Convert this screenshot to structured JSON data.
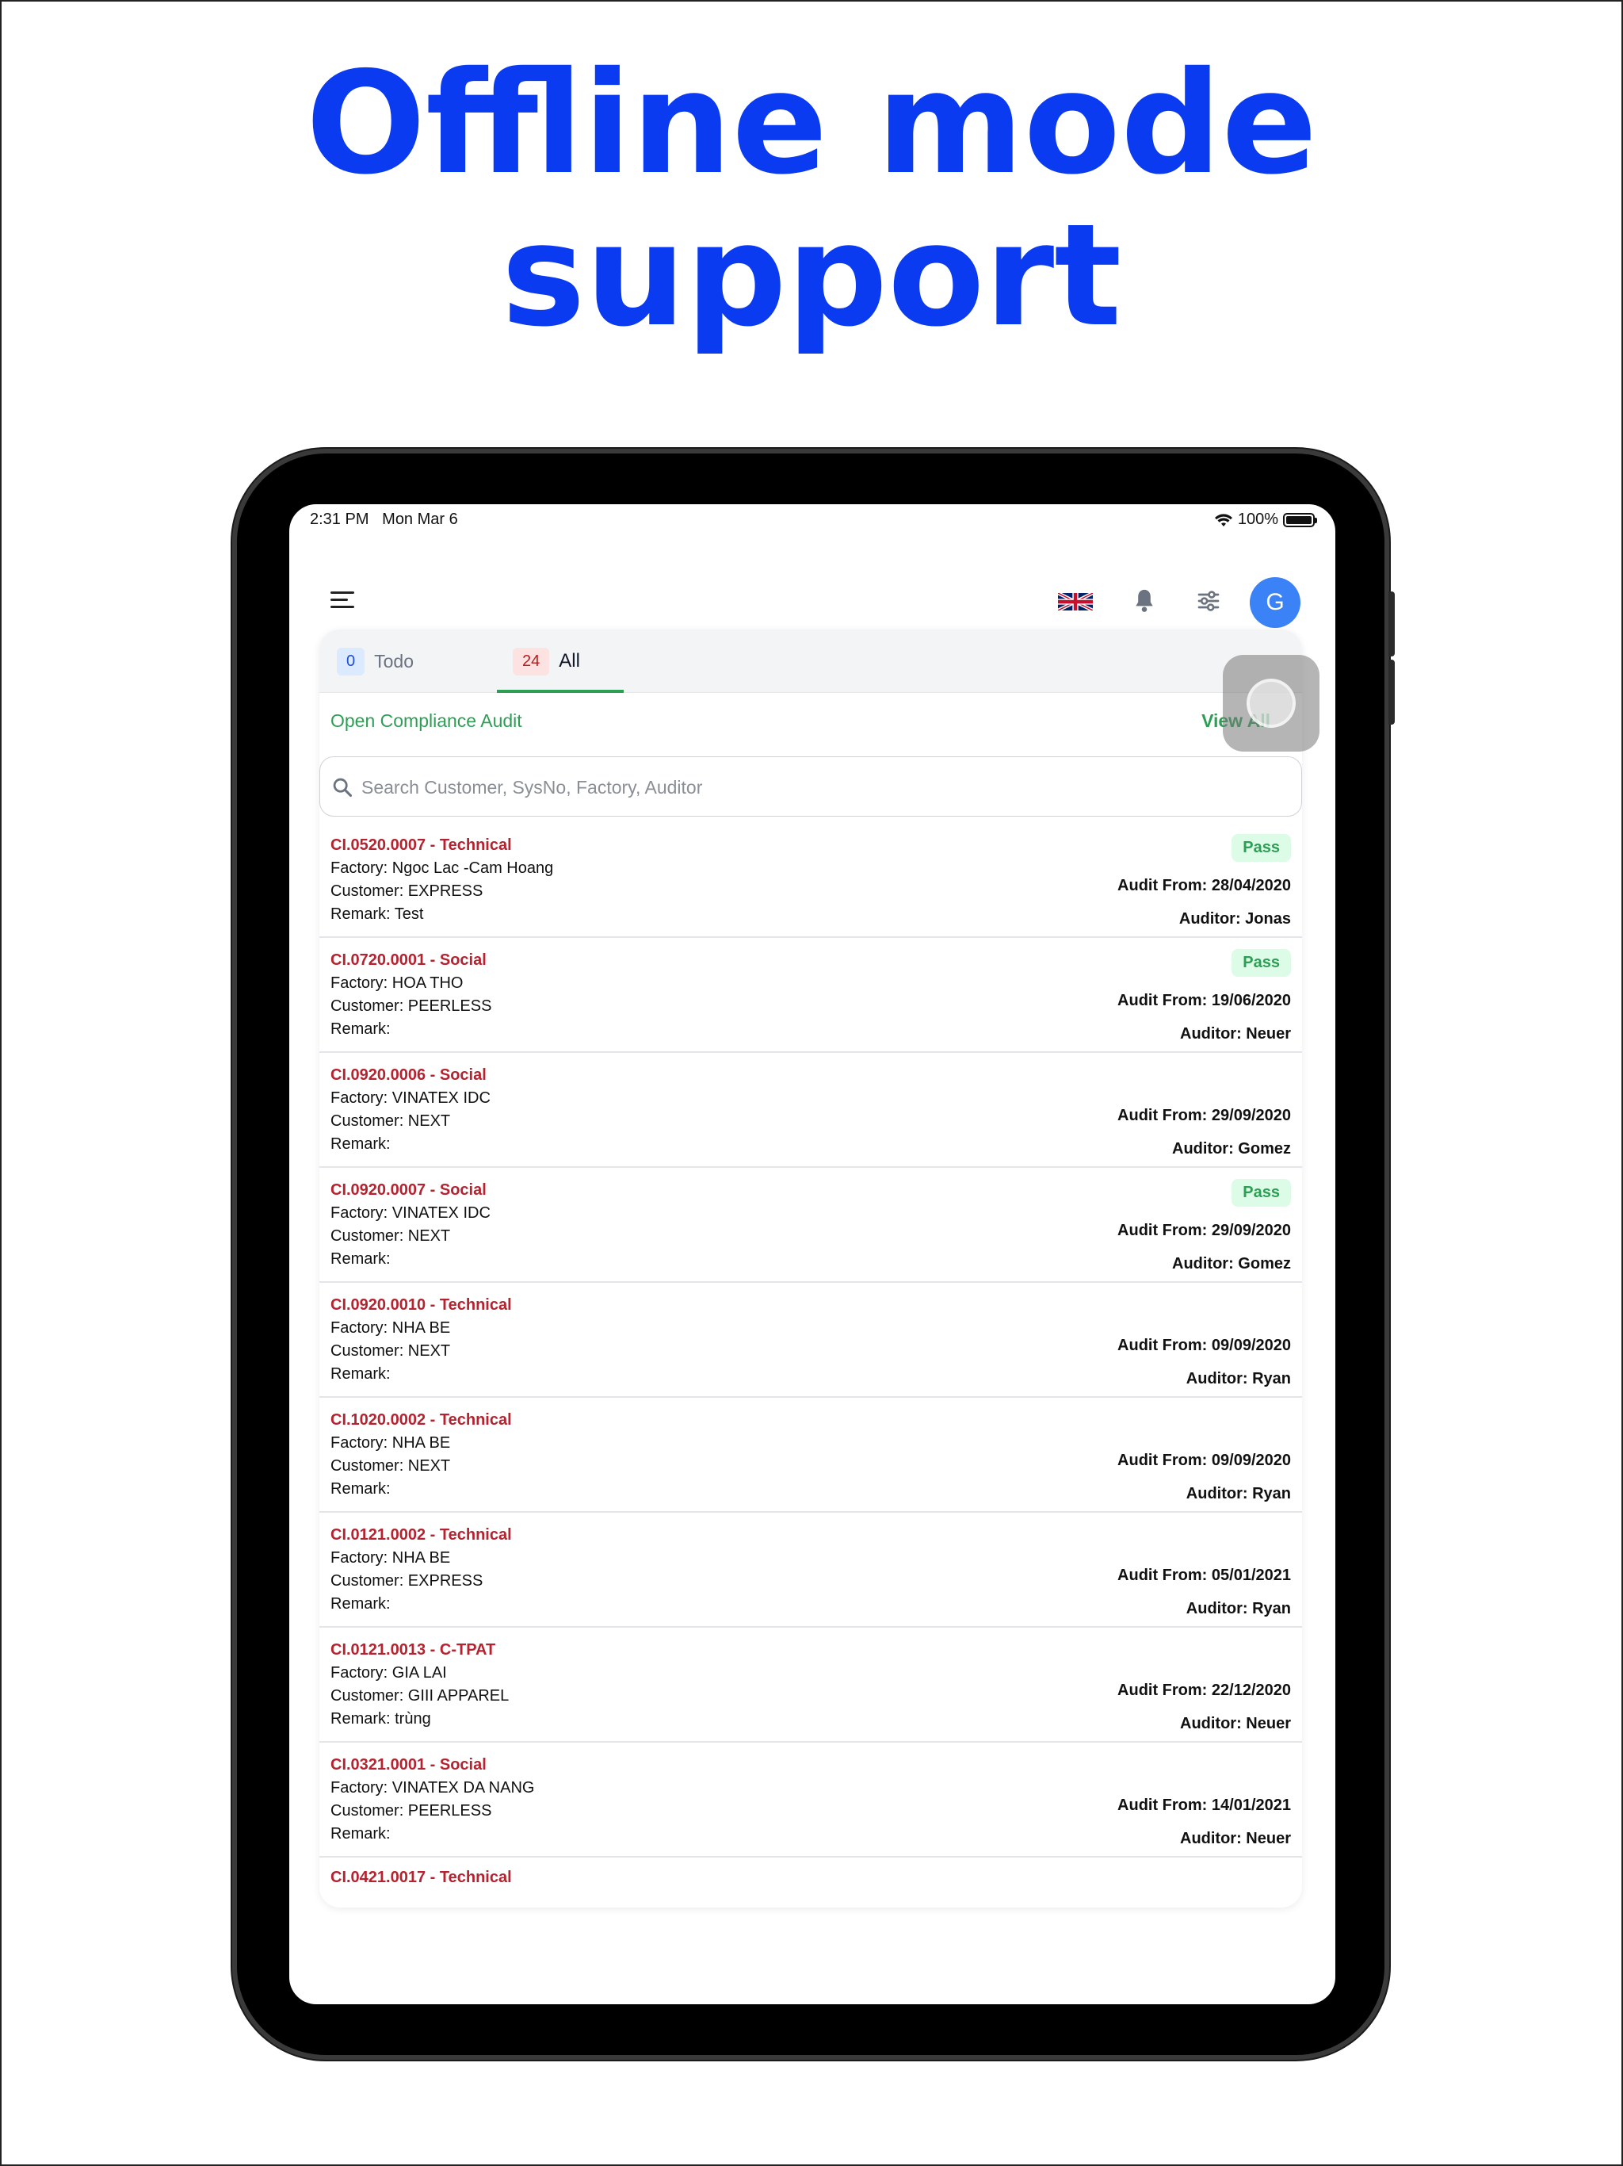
{
  "headline": {
    "line1": "Offline mode",
    "line2": "support"
  },
  "status_bar": {
    "time_date": "2:31 PM   Mon Mar 6",
    "battery": "100%",
    "battery_level": 1.0
  },
  "colors": {
    "headline": "#0b3bf0",
    "accent_green": "#2e9e55",
    "id_red": "#b4232f",
    "avatar_blue": "#3b82f6"
  },
  "toolbar": {
    "avatar_letter": "G"
  },
  "tabs": [
    {
      "count": "0",
      "label": "Todo"
    },
    {
      "count": "24",
      "label": "All"
    }
  ],
  "section": {
    "title": "Open Compliance Audit",
    "view_all": "View All"
  },
  "search": {
    "placeholder": "Search Customer, SysNo, Factory, Auditor"
  },
  "audits": [
    {
      "id": "CI.0520.0007 - Technical",
      "factory": "Factory: Ngoc Lac -Cam Hoang",
      "customer": "Customer: EXPRESS",
      "remark": "Remark: Test",
      "status": "Pass",
      "audit_from": "Audit From: 28/04/2020",
      "auditor": "Auditor: Jonas"
    },
    {
      "id": "CI.0720.0001 - Social",
      "factory": "Factory: HOA THO",
      "customer": "Customer: PEERLESS",
      "remark": "Remark:",
      "status": "Pass",
      "audit_from": "Audit From: 19/06/2020",
      "auditor": "Auditor: Neuer"
    },
    {
      "id": "CI.0920.0006 - Social",
      "factory": "Factory: VINATEX IDC",
      "customer": "Customer: NEXT",
      "remark": "Remark:",
      "status": "",
      "audit_from": "Audit From: 29/09/2020",
      "auditor": "Auditor: Gomez"
    },
    {
      "id": "CI.0920.0007 - Social",
      "factory": "Factory: VINATEX IDC",
      "customer": "Customer: NEXT",
      "remark": "Remark:",
      "status": "Pass",
      "audit_from": "Audit From: 29/09/2020",
      "auditor": "Auditor: Gomez"
    },
    {
      "id": "CI.0920.0010 - Technical",
      "factory": "Factory: NHA BE",
      "customer": "Customer: NEXT",
      "remark": "Remark:",
      "status": "",
      "audit_from": "Audit From: 09/09/2020",
      "auditor": "Auditor: Ryan"
    },
    {
      "id": "CI.1020.0002 - Technical",
      "factory": "Factory: NHA BE",
      "customer": "Customer: NEXT",
      "remark": "Remark:",
      "status": "",
      "audit_from": "Audit From: 09/09/2020",
      "auditor": "Auditor: Ryan"
    },
    {
      "id": "CI.0121.0002 - Technical",
      "factory": "Factory: NHA BE",
      "customer": "Customer: EXPRESS",
      "remark": "Remark:",
      "status": "",
      "audit_from": "Audit From: 05/01/2021",
      "auditor": "Auditor: Ryan"
    },
    {
      "id": "CI.0121.0013 - C-TPAT",
      "factory": "Factory: GIA LAI",
      "customer": "Customer: GIII APPAREL",
      "remark": "Remark: trùng",
      "status": "",
      "audit_from": "Audit From: 22/12/2020",
      "auditor": "Auditor: Neuer"
    },
    {
      "id": "CI.0321.0001 - Social",
      "factory": "Factory: VINATEX DA NANG",
      "customer": "Customer: PEERLESS",
      "remark": "Remark:",
      "status": "",
      "audit_from": "Audit From: 14/01/2021",
      "auditor": "Auditor: Neuer"
    }
  ],
  "partial_audit": {
    "id": "CI.0421.0017 - Technical"
  }
}
